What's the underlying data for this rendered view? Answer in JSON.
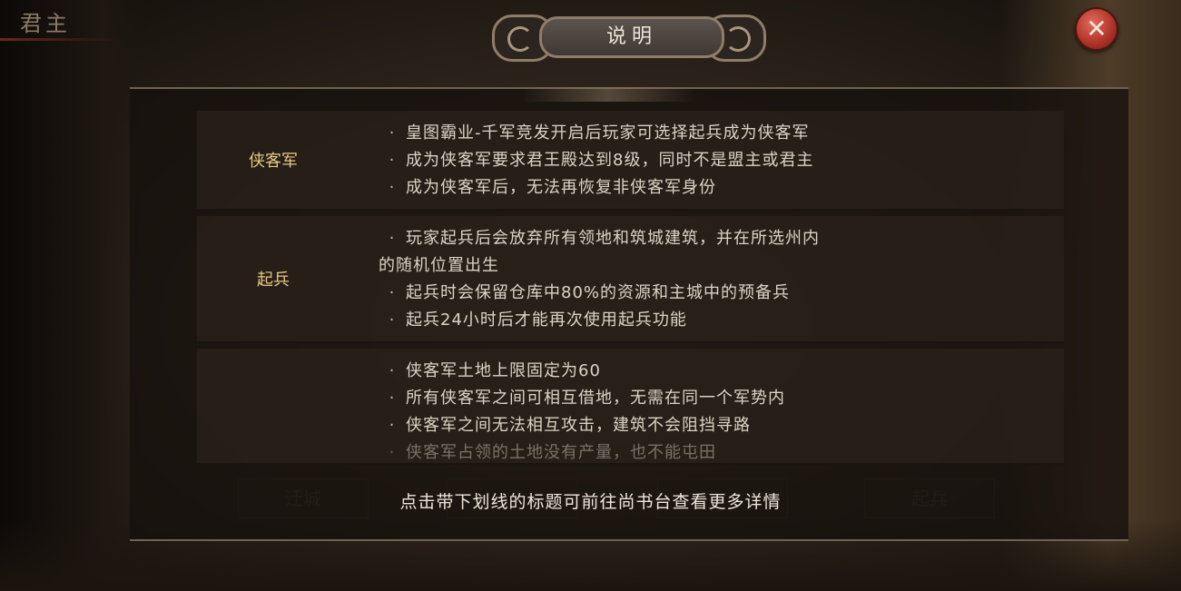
{
  "corner": {
    "title": "君主"
  },
  "dialog": {
    "title": "说明",
    "close_symbol": "✕",
    "sections": [
      {
        "label": "侠客军",
        "lines": [
          "皇图霸业-千军竞发开启后玩家可选择起兵成为侠客军",
          "成为侠客军要求君王殿达到8级，同时不是盟主或君主",
          "成为侠客军后，无法再恢复非侠客军身份"
        ]
      },
      {
        "label": "起兵",
        "lines": [
          "玩家起兵后会放弃所有领地和筑城建筑，并在所选州内",
          "的随机位置出生",
          "起兵时会保留仓库中80%的资源和主城中的预备兵",
          "起兵24小时后才能再次使用起兵功能"
        ]
      },
      {
        "label": "",
        "lines": [
          "侠客军土地上限固定为60",
          "所有侠客军之间可相互借地，无需在同一个军势内",
          "侠客军之间无法相互攻击，建筑不会阻挡寻路",
          "侠客军占领的土地没有产量，也不能屯田"
        ]
      }
    ],
    "hint": "点击带下划线的标题可前往尚书台查看更多详情"
  },
  "background_buttons": [
    "迁城",
    "",
    "",
    "起兵"
  ],
  "icons": {
    "close": "close-icon"
  },
  "colors": {
    "label_gold": "#e6c886",
    "text": "#ddd3c4",
    "close_red": "#b2352a"
  }
}
